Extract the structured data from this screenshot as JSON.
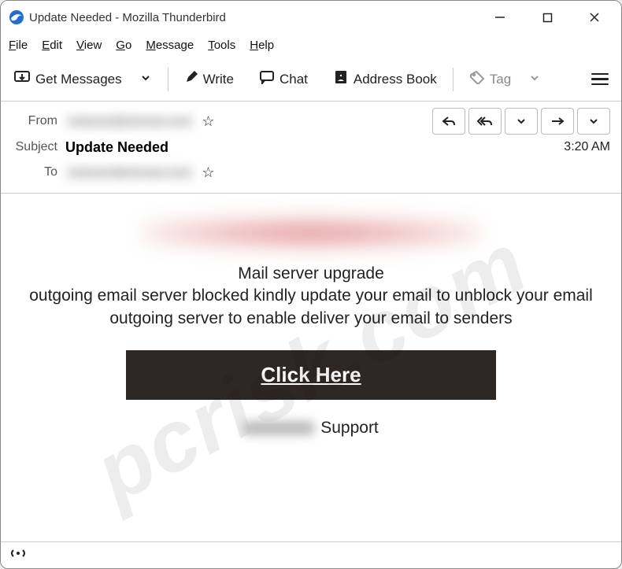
{
  "window": {
    "title": "Update Needed - Mozilla Thunderbird"
  },
  "menu": {
    "file": "File",
    "edit": "Edit",
    "view": "View",
    "go": "Go",
    "message": "Message",
    "tools": "Tools",
    "help": "Help"
  },
  "toolbar": {
    "get_messages": "Get Messages",
    "write": "Write",
    "chat": "Chat",
    "address_book": "Address Book",
    "tag": "Tag"
  },
  "header": {
    "from_label": "From",
    "from_value": "redacted@domain.com",
    "subject_label": "Subject",
    "subject_value": "Update Needed",
    "to_label": "To",
    "to_value": "redacted@domain.com",
    "time": "3:20 AM"
  },
  "body": {
    "line1": "Mail server upgrade",
    "line2": "outgoing email server blocked kindly update your email to unblock your email outgoing server to enable  deliver your email to senders",
    "cta": "Click Here",
    "support_suffix": "Support"
  },
  "watermark": "pcrisk.com"
}
